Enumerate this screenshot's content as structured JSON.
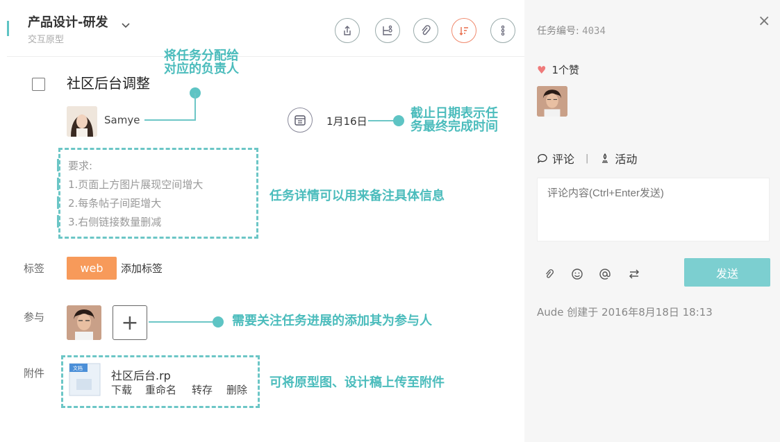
{
  "header": {
    "project_title": "产品设计-研发",
    "project_subtitle": "交互原型",
    "buttons": [
      "share-icon",
      "flow-icon",
      "attach-icon",
      "priority-icon",
      "more-icon"
    ]
  },
  "task": {
    "title": "社区后台调整",
    "assignee": "Samye",
    "due_date": "1月16日",
    "description": [
      "要求:",
      "1.页面上方图片展现空间增大",
      "2.每条帖子间距增大",
      "3.右侧链接数量删减"
    ]
  },
  "fields": {
    "tags_label": "标签",
    "tag": "web",
    "add_tag": "添加标签",
    "participants_label": "参与",
    "add_participant": "+",
    "attachments_label": "附件",
    "file_icon_text": "文档",
    "file_name": "社区后台.rp",
    "file_actions": [
      "下载",
      "重命名",
      "转存",
      "删除"
    ]
  },
  "annotations": {
    "assign_1": "将任务分配给",
    "assign_2": "对应的负责人",
    "due_1": "截止日期表示任",
    "due_2": "务最终完成时间",
    "desc": "任务详情可以用来备注具体信息",
    "participants": "需要关注任务进展的添加其为参与人",
    "attachments": "可将原型图、设计稿上传至附件"
  },
  "side": {
    "task_number_label": "任务编号:",
    "task_number": "4034",
    "close": "×",
    "likes": "1个赞",
    "tab_comment": "评论",
    "tab_separator": "|",
    "tab_activity": "活动",
    "comment_placeholder": "评论内容(Ctrl+Enter发送)",
    "send": "发送",
    "activity_log": "Aude  创建于 2016年8月18日 18:13"
  },
  "colors": {
    "accent": "#5ec4c4",
    "tag": "#f79a5a",
    "send": "#7ccfd0",
    "heart": "#ef7a7a"
  }
}
